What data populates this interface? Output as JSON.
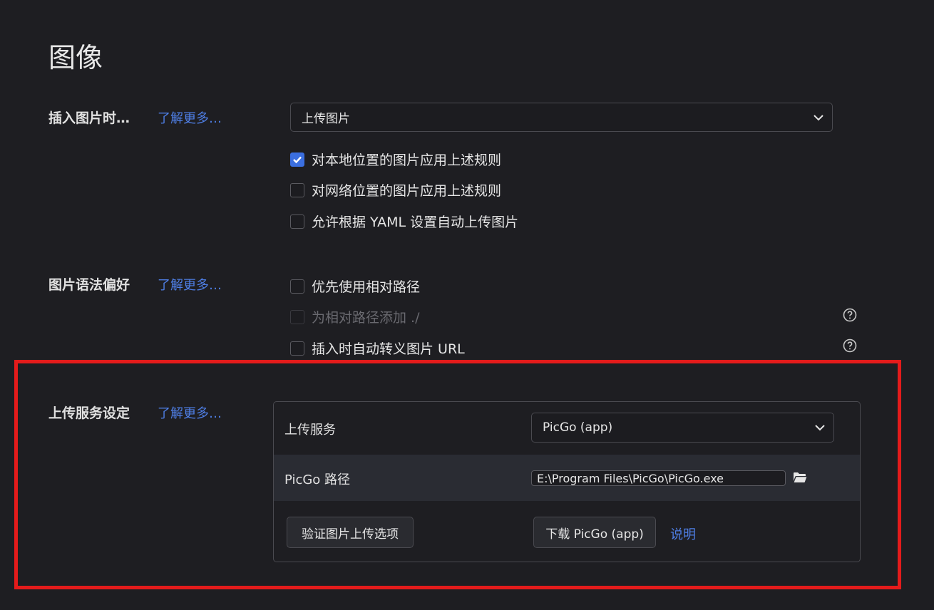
{
  "page_title": "图像",
  "insert": {
    "label": "插入图片时…",
    "more": "了解更多…",
    "select_value": "上传图片",
    "options": [
      {
        "label": "对本地位置的图片应用上述规则",
        "checked": true,
        "disabled": false
      },
      {
        "label": "对网络位置的图片应用上述规则",
        "checked": false,
        "disabled": false
      },
      {
        "label": "允许根据 YAML 设置自动上传图片",
        "checked": false,
        "disabled": false
      }
    ]
  },
  "syntax": {
    "label": "图片语法偏好",
    "more": "了解更多…",
    "options": [
      {
        "label": "优先使用相对路径",
        "checked": false,
        "disabled": false
      },
      {
        "label": "为相对路径添加 ./",
        "checked": false,
        "disabled": true
      },
      {
        "label": "插入时自动转义图片 URL",
        "checked": false,
        "disabled": false
      }
    ]
  },
  "upload": {
    "label": "上传服务设定",
    "more": "了解更多…",
    "service_label": "上传服务",
    "service_value": "PicGo (app)",
    "path_label": "PicGo 路径",
    "path_value": "E:\\Program Files\\PicGo\\PicGo.exe",
    "verify_button": "验证图片上传选项",
    "download_button": "下载 PicGo (app)",
    "help_link": "说明"
  },
  "colors": {
    "accent": "#3b6fe0",
    "link": "#4f7fe6",
    "highlight_frame": "#e41b1b",
    "background": "#1e1e22"
  }
}
